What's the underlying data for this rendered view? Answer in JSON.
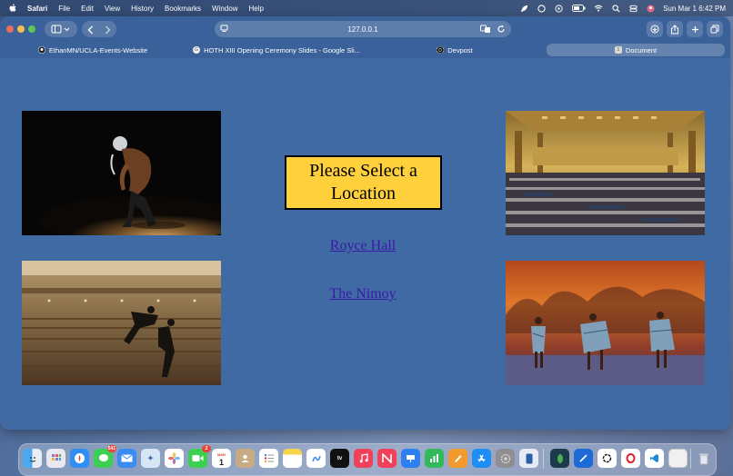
{
  "menubar": {
    "app_name": "Safari",
    "items": [
      "File",
      "Edit",
      "View",
      "History",
      "Bookmarks",
      "Window",
      "Help"
    ],
    "clock": "Sun Mar 1  6:42 PM"
  },
  "toolbar": {
    "url": "127.0.0.1"
  },
  "tabs": [
    {
      "label": "EthanMN/UCLA-Events-Website",
      "icon": "github-icon"
    },
    {
      "label": "HOTH XIII Opening Ceremony Slides - Google Sli...",
      "icon": "google-slides-icon"
    },
    {
      "label": "Devpost",
      "icon": "devpost-icon"
    },
    {
      "label": "Document",
      "icon": "document-icon",
      "active": true
    }
  ],
  "page": {
    "heading": "Please Select a Location",
    "links": [
      {
        "label": "Royce Hall"
      },
      {
        "label": "The Nimoy"
      }
    ],
    "colors": {
      "background": "#3f6aa3",
      "heading_box": "#fdd03c",
      "link": "#3b1aa6"
    }
  },
  "dock": {
    "badges": {
      "mail": "541",
      "facetime": "2",
      "calendar_day": "1"
    },
    "calendar_month": "MAR"
  }
}
